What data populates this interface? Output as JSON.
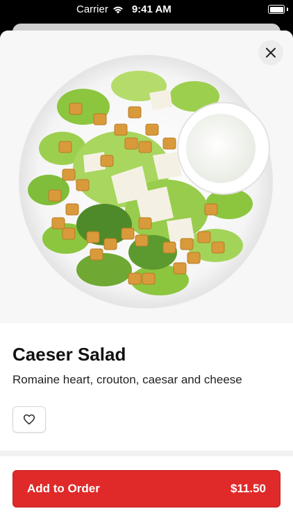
{
  "status_bar": {
    "carrier": "Carrier",
    "time": "9:41 AM"
  },
  "item": {
    "name": "Caeser Salad",
    "description": "Romaine heart, crouton, caesar and cheese",
    "image_icon": "caesar-salad-photo"
  },
  "actions": {
    "close_icon": "close-icon",
    "favorite_icon": "heart-icon",
    "add_to_order_label": "Add to Order",
    "price": "$11.50"
  },
  "colors": {
    "accent": "#e02a2a",
    "background": "#ffffff",
    "text": "#111111"
  }
}
